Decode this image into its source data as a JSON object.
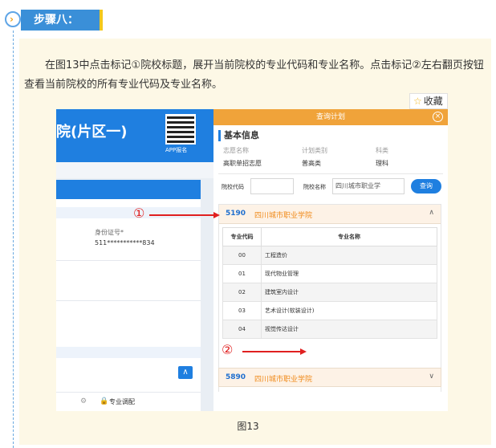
{
  "step": {
    "label": "步骤八："
  },
  "instruction": "在图13中点击标记①院校标题，展开当前院校的专业代码和专业名称。点击标记②左右翻页按钮查看当前院校的所有专业代码及专业名称。",
  "favorite": {
    "label": "收藏"
  },
  "background_page": {
    "title": "院(片区一)",
    "qr_label": "APP报名",
    "id_label": "身份证号*",
    "id_value": "511***********834",
    "footer_item": "专业调配"
  },
  "modal": {
    "title": "查询计划",
    "close": "×",
    "basic_info_title": "基本信息",
    "info": [
      {
        "label": "志愿名称",
        "value": "高职单招志愿"
      },
      {
        "label": "计划类别",
        "value": "普高类"
      },
      {
        "label": "科类",
        "value": "理科"
      }
    ],
    "search": {
      "code_label": "院校代码",
      "code_value": "",
      "name_label": "院校名称",
      "name_value": "四川城市职业学",
      "button": "查询"
    },
    "school1": {
      "code": "5190",
      "name": "四川城市职业学院",
      "chevron": "∧"
    },
    "table": {
      "headers": [
        "专业代码",
        "专业名称"
      ],
      "rows": [
        {
          "code": "00",
          "name": "工程造价"
        },
        {
          "code": "01",
          "name": "现代物业管理"
        },
        {
          "code": "02",
          "name": "建筑室内设计"
        },
        {
          "code": "03",
          "name": "艺术设计(软装设计)"
        },
        {
          "code": "04",
          "name": "视觉传达设计"
        }
      ]
    },
    "pager": {
      "prev": "‹",
      "next": "›"
    },
    "school2": {
      "code": "5890",
      "name": "四川城市职业学院",
      "chevron": "∨"
    }
  },
  "markers": {
    "m1": "①",
    "m2": "②"
  },
  "caption": "图13"
}
